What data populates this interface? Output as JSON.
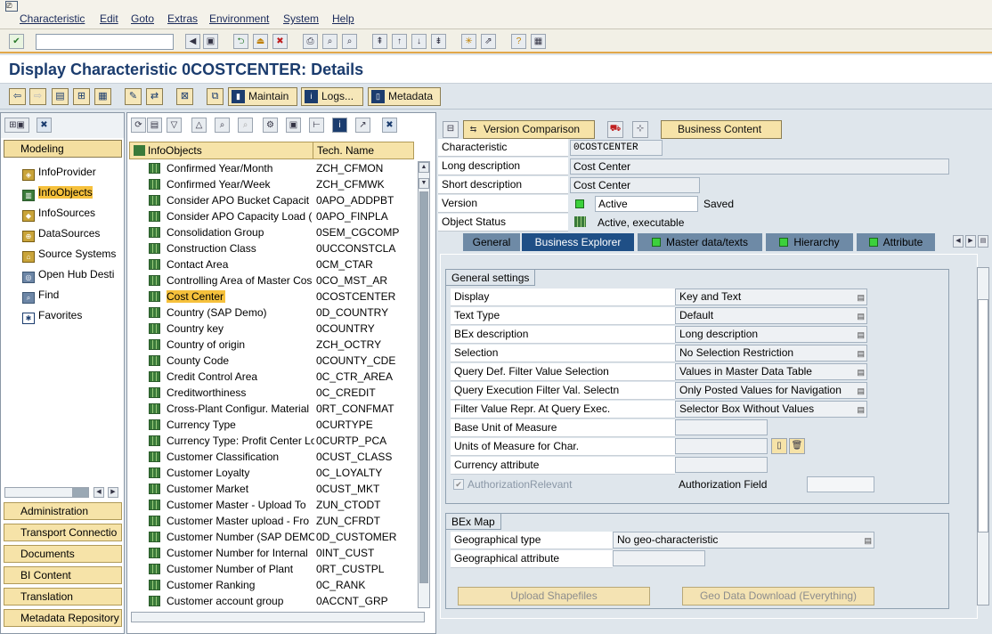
{
  "menu": [
    "Characteristic",
    "Edit",
    "Goto",
    "Extras",
    "Environment",
    "System",
    "Help"
  ],
  "title": "Display Characteristic 0COSTCENTER: Details",
  "toolbar": {
    "maintain": "Maintain",
    "logs": "Logs...",
    "metadata": "Metadata"
  },
  "nav": {
    "modeling": "Modeling",
    "items": [
      "InfoProvider",
      "InfoObjects",
      "InfoSources",
      "DataSources",
      "Source Systems",
      "Open Hub Desti",
      "Find",
      "Favorites"
    ],
    "bottom": [
      "Administration",
      "Transport Connectio",
      "Documents",
      "BI Content",
      "Translation",
      "Metadata Repository"
    ]
  },
  "tree": {
    "col1": "InfoObjects",
    "col2": "Tech. Name",
    "rows": [
      [
        "Confirmed Year/Month",
        "ZCH_CFMON"
      ],
      [
        "Confirmed Year/Week",
        "ZCH_CFMWK"
      ],
      [
        "Consider APO Bucket Capacit",
        "0APO_ADDPBT"
      ],
      [
        "Consider APO Capacity Load (",
        "0APO_FINPLA"
      ],
      [
        "Consolidation Group",
        "0SEM_CGCOMP"
      ],
      [
        "Construction Class",
        "0UCCONSTCLA"
      ],
      [
        "Contact Area",
        "0CM_CTAR"
      ],
      [
        "Controlling Area of Master Cos",
        "0CO_MST_AR"
      ],
      [
        "Cost Center",
        "0COSTCENTER"
      ],
      [
        "Country (SAP Demo)",
        "0D_COUNTRY"
      ],
      [
        "Country key",
        "0COUNTRY"
      ],
      [
        "Country of origin",
        "ZCH_OCTRY"
      ],
      [
        "County Code",
        "0COUNTY_CDE"
      ],
      [
        "Credit Control Area",
        "0C_CTR_AREA"
      ],
      [
        "Creditworthiness",
        "0C_CREDIT"
      ],
      [
        "Cross-Plant Configur. Material",
        "0RT_CONFMAT"
      ],
      [
        "Currency Type",
        "0CURTYPE"
      ],
      [
        "Currency Type: Profit Center Lo",
        "0CURTP_PCA"
      ],
      [
        "Customer Classification",
        "0CUST_CLASS"
      ],
      [
        "Customer Loyalty",
        "0C_LOYALTY"
      ],
      [
        "Customer Market",
        "0CUST_MKT"
      ],
      [
        "Customer Master - Upload To",
        "ZUN_CTODT"
      ],
      [
        "Customer Master upload - Fro",
        "ZUN_CFRDT"
      ],
      [
        "Customer Number (SAP DEMO",
        "0D_CUSTOMER"
      ],
      [
        "Customer Number for Internal",
        "0INT_CUST"
      ],
      [
        "Customer Number of Plant",
        "0RT_CUSTPL"
      ],
      [
        "Customer Ranking",
        "0C_RANK"
      ],
      [
        "Customer account group",
        "0ACCNT_GRP"
      ]
    ]
  },
  "rtoolbar": {
    "version_comparison": "Version Comparison",
    "business_content": "Business Content"
  },
  "header": {
    "labels": [
      "Characteristic",
      "Long description",
      "Short description",
      "Version",
      "Object Status"
    ],
    "characteristic": "0COSTCENTER",
    "long_desc": "Cost Center",
    "short_desc": "Cost Center",
    "version": "Active",
    "saved": "Saved",
    "object_status": "Active, executable"
  },
  "tabs": [
    "General",
    "Business Explorer",
    "Master data/texts",
    "Hierarchy",
    "Attribute"
  ],
  "general": {
    "group_title": "General settings",
    "rows": [
      {
        "label": "Display",
        "value": "Key and Text"
      },
      {
        "label": "Text Type",
        "value": "Default"
      },
      {
        "label": "BEx description",
        "value": "Long description"
      },
      {
        "label": "Selection",
        "value": "No Selection Restriction"
      },
      {
        "label": "Query Def. Filter Value Selection",
        "value": "Values in Master Data Table"
      },
      {
        "label": "Query Execution Filter Val. Selectn",
        "value": "Only Posted Values for Navigation"
      },
      {
        "label": "Filter Value Repr. At Query Exec.",
        "value": "Selector Box Without Values"
      }
    ],
    "base_uom": "Base Unit of Measure",
    "uom_char": "Units of Measure for Char.",
    "currency_attr": "Currency attribute",
    "auth_relevant": "AuthorizationRelevant",
    "auth_field": "Authorization Field"
  },
  "bexmap": {
    "group_title": "BEx Map",
    "geo_type_label": "Geographical type",
    "geo_type_value": "No geo-characteristic",
    "geo_attr_label": "Geographical attribute",
    "upload_btn": "Upload Shapefiles",
    "download_btn": "Geo Data Download (Everything)"
  }
}
